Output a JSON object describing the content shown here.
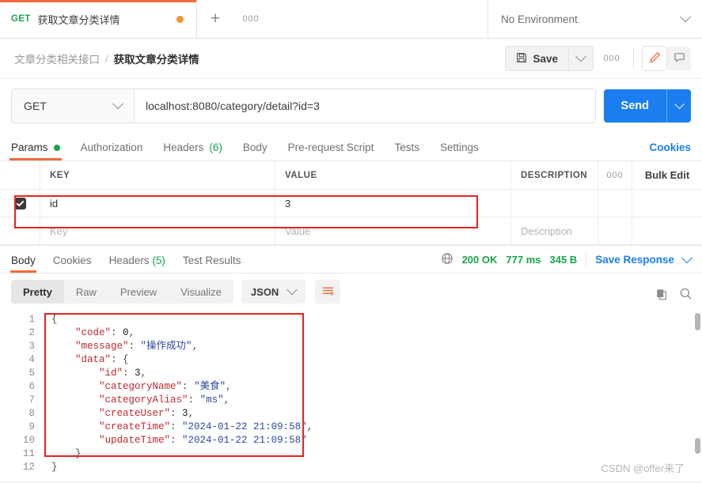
{
  "tabstrip": {
    "method": "GET",
    "title": "获取文章分类详情",
    "plus": "+",
    "ellipsis": "000",
    "environment": "No Environment"
  },
  "breadcrumb": {
    "collection": "文章分类相关接口",
    "separator": "/",
    "current": "获取文章分类详情",
    "save_label": "Save",
    "more_label": "000"
  },
  "url": {
    "method": "GET",
    "value": "localhost:8080/category/detail?id=3",
    "send_label": "Send"
  },
  "request_tabs": {
    "items": [
      {
        "label": "Params",
        "dot": true
      },
      {
        "label": "Authorization"
      },
      {
        "label": "Headers",
        "count": "(6)"
      },
      {
        "label": "Body"
      },
      {
        "label": "Pre-request Script"
      },
      {
        "label": "Tests"
      },
      {
        "label": "Settings"
      }
    ],
    "cookies_link": "Cookies"
  },
  "params_table": {
    "headers": {
      "key": "KEY",
      "value": "VALUE",
      "description": "DESCRIPTION",
      "dots": "000",
      "bulk_edit": "Bulk Edit"
    },
    "rows": [
      {
        "checked": true,
        "key": "id",
        "value": "3",
        "description": ""
      }
    ],
    "placeholder_row": {
      "key": "Key",
      "value": "Value",
      "description": "Description"
    }
  },
  "response": {
    "tabs": [
      {
        "label": "Body"
      },
      {
        "label": "Cookies"
      },
      {
        "label": "Headers",
        "count": "(5)"
      },
      {
        "label": "Test Results"
      }
    ],
    "status": "200 OK",
    "time": "777 ms",
    "size": "345 B",
    "save_response": "Save Response",
    "format_tabs": [
      "Pretty",
      "Raw",
      "Preview",
      "Visualize"
    ],
    "format_selected": "Pretty",
    "language": "JSON"
  },
  "body_json": {
    "lines": [
      {
        "n": "1",
        "tokens": [
          {
            "t": "{",
            "c": "p"
          }
        ]
      },
      {
        "n": "2",
        "tokens": [
          {
            "t": "    ",
            "c": "p"
          },
          {
            "t": "\"code\"",
            "c": "k"
          },
          {
            "t": ": ",
            "c": "p"
          },
          {
            "t": "0",
            "c": "n"
          },
          {
            "t": ",",
            "c": "p"
          }
        ]
      },
      {
        "n": "3",
        "tokens": [
          {
            "t": "    ",
            "c": "p"
          },
          {
            "t": "\"message\"",
            "c": "k"
          },
          {
            "t": ": ",
            "c": "p"
          },
          {
            "t": "\"操作成功\"",
            "c": "s"
          },
          {
            "t": ",",
            "c": "p"
          }
        ]
      },
      {
        "n": "4",
        "tokens": [
          {
            "t": "    ",
            "c": "p"
          },
          {
            "t": "\"data\"",
            "c": "k"
          },
          {
            "t": ": ",
            "c": "p"
          },
          {
            "t": "{",
            "c": "p"
          }
        ]
      },
      {
        "n": "5",
        "tokens": [
          {
            "t": "        ",
            "c": "p"
          },
          {
            "t": "\"id\"",
            "c": "k"
          },
          {
            "t": ": ",
            "c": "p"
          },
          {
            "t": "3",
            "c": "n"
          },
          {
            "t": ",",
            "c": "p"
          }
        ]
      },
      {
        "n": "6",
        "tokens": [
          {
            "t": "        ",
            "c": "p"
          },
          {
            "t": "\"categoryName\"",
            "c": "k"
          },
          {
            "t": ": ",
            "c": "p"
          },
          {
            "t": "\"美食\"",
            "c": "s"
          },
          {
            "t": ",",
            "c": "p"
          }
        ]
      },
      {
        "n": "7",
        "tokens": [
          {
            "t": "        ",
            "c": "p"
          },
          {
            "t": "\"categoryAlias\"",
            "c": "k"
          },
          {
            "t": ": ",
            "c": "p"
          },
          {
            "t": "\"ms\"",
            "c": "s"
          },
          {
            "t": ",",
            "c": "p"
          }
        ]
      },
      {
        "n": "8",
        "tokens": [
          {
            "t": "        ",
            "c": "p"
          },
          {
            "t": "\"createUser\"",
            "c": "k"
          },
          {
            "t": ": ",
            "c": "p"
          },
          {
            "t": "3",
            "c": "n"
          },
          {
            "t": ",",
            "c": "p"
          }
        ]
      },
      {
        "n": "9",
        "tokens": [
          {
            "t": "        ",
            "c": "p"
          },
          {
            "t": "\"createTime\"",
            "c": "k"
          },
          {
            "t": ": ",
            "c": "p"
          },
          {
            "t": "\"2024-01-22 21:09:58\"",
            "c": "s"
          },
          {
            "t": ",",
            "c": "p"
          }
        ]
      },
      {
        "n": "10",
        "tokens": [
          {
            "t": "        ",
            "c": "p"
          },
          {
            "t": "\"updateTime\"",
            "c": "k"
          },
          {
            "t": ": ",
            "c": "p"
          },
          {
            "t": "\"2024-01-22 21:09:58\"",
            "c": "s"
          }
        ]
      },
      {
        "n": "11",
        "tokens": [
          {
            "t": "    }",
            "c": "p"
          }
        ]
      },
      {
        "n": "12",
        "tokens": [
          {
            "t": "}",
            "c": "p"
          }
        ]
      }
    ]
  },
  "watermark": "CSDN @offer来了",
  "colors": {
    "accent_orange": "#f26b3a",
    "send_blue": "#1a7ef0",
    "status_green": "#19a34a",
    "annotation_red": "#e8231f"
  }
}
